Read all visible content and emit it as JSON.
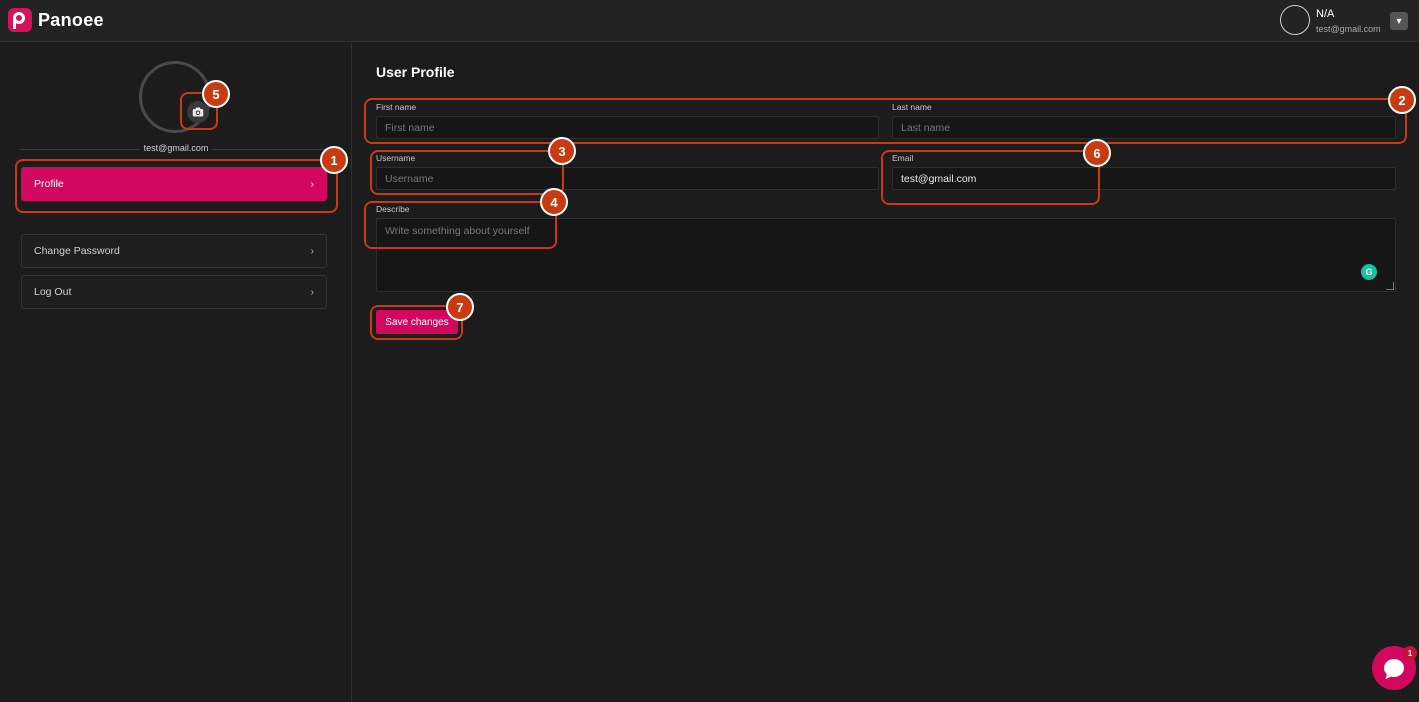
{
  "app": {
    "brand": "Panoee",
    "brand_color": "#d4075f"
  },
  "header": {
    "user_name": "N/A",
    "user_email": "test@gmail.com",
    "dropdown_icon": "chevron-down-icon"
  },
  "sidebar": {
    "email": "test@gmail.com",
    "camera_icon": "camera-icon",
    "items": [
      {
        "label": "Profile",
        "active": true
      },
      {
        "label": "Change Password",
        "active": false
      },
      {
        "label": "Log Out",
        "active": false
      }
    ],
    "chevron": "›"
  },
  "main": {
    "title": "User Profile",
    "fields": {
      "first_name": {
        "label": "First name",
        "placeholder": "First name",
        "value": ""
      },
      "last_name": {
        "label": "Last name",
        "placeholder": "Last name",
        "value": ""
      },
      "username": {
        "label": "Username",
        "placeholder": "Username",
        "value": ""
      },
      "email": {
        "label": "Email",
        "placeholder": "",
        "value": "test@gmail.com"
      },
      "describe": {
        "label": "Describe",
        "placeholder": "Write something about yourself",
        "value": ""
      }
    },
    "save_label": "Save changes"
  },
  "annotations": [
    "1",
    "2",
    "3",
    "4",
    "5",
    "6",
    "7"
  ],
  "annotation_color": "#c83a10",
  "chat": {
    "count": "1"
  }
}
